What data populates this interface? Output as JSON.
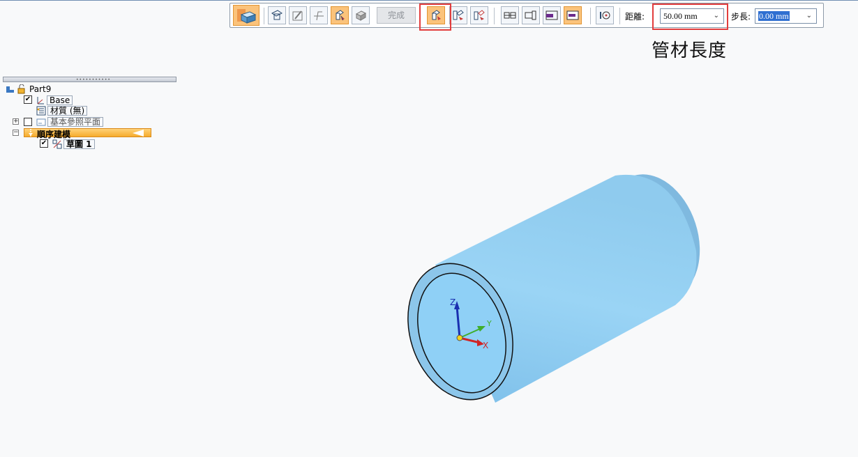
{
  "toolbar": {
    "done_label": "完成",
    "distance_label": "距離:",
    "distance_value": "50.00 mm",
    "step_label": "步長:",
    "step_value": "0.00 mm",
    "active_color": "#fbc37b",
    "highlight_color": "#e23d3d"
  },
  "callout": {
    "text": "管材長度"
  },
  "tree": {
    "root_label": "Part9",
    "base_label": "Base",
    "material_label": "材質 (無)",
    "ref_planes_label": "基本參照平面",
    "sequential_label": "順序建模",
    "sketch_label": "草圖 1"
  },
  "viewport": {
    "axis_x": "X",
    "axis_y": "Y",
    "axis_z": "Z",
    "model_color": "#92cdf0"
  }
}
